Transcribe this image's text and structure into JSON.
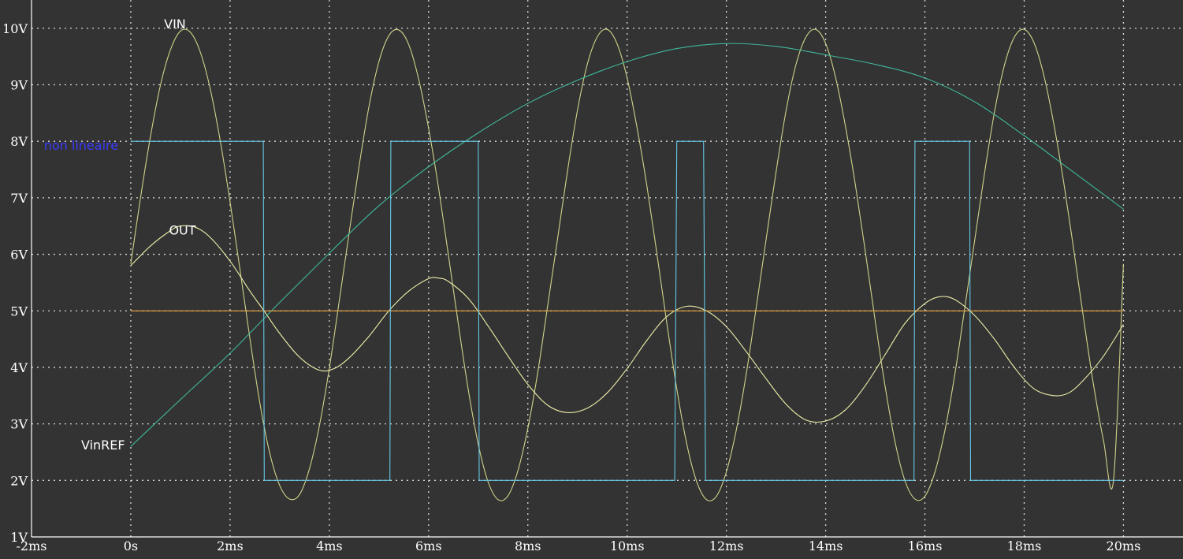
{
  "chart_data": {
    "type": "line",
    "title": "",
    "xlabel": "",
    "ylabel": "",
    "xlim": [
      -2,
      21.2
    ],
    "ylim": [
      1,
      10.5
    ],
    "x_unit": "ms",
    "y_unit": "V",
    "grid": true,
    "xticks": [
      "-2ms",
      "0s",
      "2ms",
      "4ms",
      "6ms",
      "8ms",
      "10ms",
      "12ms",
      "14ms",
      "16ms",
      "18ms",
      "20ms"
    ],
    "xtick_values": [
      -2,
      0,
      2,
      4,
      6,
      8,
      10,
      12,
      14,
      16,
      18,
      20
    ],
    "yticks": [
      "1V",
      "2V",
      "3V",
      "4V",
      "5V",
      "6V",
      "7V",
      "8V",
      "9V",
      "10V"
    ],
    "ytick_values": [
      1,
      2,
      3,
      4,
      5,
      6,
      7,
      8,
      9,
      10
    ],
    "annotation": {
      "text": "non lineaire",
      "color": "#3a3aff",
      "anchor": [
        -1.75,
        7.85
      ]
    },
    "series": [
      {
        "name": "VIN",
        "color": "#d0d28a",
        "label_anchor": [
          0.67,
          10.0
        ],
        "x": [
          0,
          0.2,
          0.4,
          0.6,
          0.8,
          1.0,
          1.2,
          1.4,
          1.6,
          1.8,
          2.0,
          2.2,
          2.4,
          2.6,
          2.8,
          3.0,
          3.2,
          3.4,
          3.6,
          3.8,
          4.0,
          4.2,
          4.4,
          4.6,
          4.8,
          5.0,
          5.2,
          5.4,
          5.6,
          5.8,
          6.0,
          6.2,
          6.4,
          6.6,
          6.8,
          7.0,
          7.2,
          7.4,
          7.6,
          7.8,
          8.0,
          8.2,
          8.4,
          8.6,
          8.8,
          9.0,
          9.2,
          9.4,
          9.6,
          9.8,
          10.0,
          10.2,
          10.4,
          10.6,
          10.8,
          11.0,
          11.2,
          11.4,
          11.6,
          11.8,
          12.0,
          12.2,
          12.4,
          12.6,
          12.8,
          13.0,
          13.2,
          13.4,
          13.6,
          13.8,
          14.0,
          14.2,
          14.4,
          14.6,
          14.8,
          15.0,
          15.2,
          15.4,
          15.6,
          15.8,
          16.0,
          16.2,
          16.4,
          16.6,
          16.8,
          17.0,
          17.2,
          17.4,
          17.6,
          17.8,
          18.0,
          18.2,
          18.4,
          18.6,
          18.8,
          19.0,
          19.2,
          19.4,
          19.6,
          19.8,
          20.0
        ],
        "y": [
          5.83,
          7.02,
          8.1,
          9.0,
          9.62,
          9.95,
          9.93,
          9.58,
          8.93,
          8.02,
          6.93,
          5.73,
          4.51,
          3.37,
          2.48,
          1.91,
          1.67,
          1.75,
          2.21,
          2.97,
          3.98,
          5.17,
          6.38,
          7.56,
          8.62,
          9.41,
          9.87,
          9.97,
          9.71,
          9.1,
          8.23,
          7.18,
          5.98,
          4.76,
          3.6,
          2.64,
          1.97,
          1.66,
          1.73,
          2.17,
          2.92,
          3.91,
          5.09,
          6.28,
          7.48,
          8.55,
          9.37,
          9.85,
          9.98,
          9.72,
          9.12,
          8.24,
          7.2,
          6.01,
          4.78,
          3.62,
          2.65,
          1.98,
          1.66,
          1.72,
          2.15,
          2.89,
          3.88,
          5.05,
          6.26,
          7.45,
          8.53,
          9.35,
          9.84,
          9.98,
          9.73,
          9.13,
          8.26,
          7.22,
          6.04,
          4.81,
          3.65,
          2.67,
          1.99,
          1.67,
          1.72,
          2.14,
          2.87,
          3.86,
          5.03,
          6.23,
          7.43,
          8.51,
          9.34,
          9.84,
          9.98,
          9.74,
          9.15,
          8.29,
          7.25,
          6.07,
          4.84,
          3.68,
          2.7,
          2.0,
          5.83
        ]
      },
      {
        "name": "OUT",
        "color": "#eeeeaa",
        "label_anchor": [
          0.77,
          6.35
        ],
        "x": [
          0,
          0.4,
          0.8,
          1.0,
          1.3,
          1.6,
          2.0,
          2.4,
          2.7,
          3.0,
          3.4,
          3.8,
          4.1,
          4.4,
          4.8,
          5.2,
          5.6,
          6.0,
          6.2,
          6.4,
          6.8,
          7.2,
          7.6,
          8.0,
          8.4,
          8.8,
          9.2,
          9.6,
          10.0,
          10.4,
          10.8,
          11.2,
          11.6,
          12.0,
          12.4,
          12.8,
          13.2,
          13.6,
          14.0,
          14.4,
          14.8,
          15.2,
          15.6,
          16.0,
          16.3,
          16.6,
          17.0,
          17.4,
          17.8,
          18.2,
          18.6,
          18.9,
          19.2,
          19.6,
          20.0
        ],
        "y": [
          5.8,
          6.15,
          6.42,
          6.5,
          6.48,
          6.3,
          5.88,
          5.35,
          4.98,
          4.6,
          4.18,
          3.95,
          3.98,
          4.17,
          4.55,
          5.0,
          5.35,
          5.57,
          5.58,
          5.52,
          5.22,
          4.73,
          4.2,
          3.7,
          3.33,
          3.2,
          3.28,
          3.55,
          3.98,
          4.48,
          4.9,
          5.08,
          5.0,
          4.72,
          4.28,
          3.8,
          3.35,
          3.07,
          3.05,
          3.25,
          3.68,
          4.23,
          4.78,
          5.13,
          5.25,
          5.2,
          4.92,
          4.5,
          4.0,
          3.62,
          3.5,
          3.55,
          3.78,
          4.2,
          4.76
        ]
      },
      {
        "name": "VinREF",
        "color": "#3fb69a",
        "label_anchor": [
          -1.0,
          2.55
        ],
        "x": [
          0,
          1,
          2,
          3,
          4,
          5,
          6,
          7,
          8,
          9,
          10,
          11,
          12,
          13,
          14,
          15,
          16,
          17,
          18,
          19,
          20
        ],
        "y": [
          2.6,
          3.43,
          4.25,
          5.15,
          6.02,
          6.86,
          7.55,
          8.15,
          8.67,
          9.08,
          9.41,
          9.64,
          9.73,
          9.68,
          9.53,
          9.36,
          9.12,
          8.7,
          8.1,
          7.45,
          6.8
        ]
      },
      {
        "name": "",
        "color": "#e9a43c",
        "x": [
          0,
          20
        ],
        "y": [
          5.0,
          5.0
        ]
      },
      {
        "name": "",
        "color": "#66c8e6",
        "x": [
          0,
          2.67,
          2.69,
          5.22,
          5.24,
          7.0,
          7.02,
          10.96,
          11.0,
          11.54,
          11.58,
          15.78,
          15.8,
          16.9,
          16.92,
          20
        ],
        "y": [
          8,
          8,
          2,
          2,
          8,
          8,
          2,
          2,
          8,
          8,
          2,
          2,
          8,
          8,
          2,
          2
        ]
      }
    ]
  }
}
